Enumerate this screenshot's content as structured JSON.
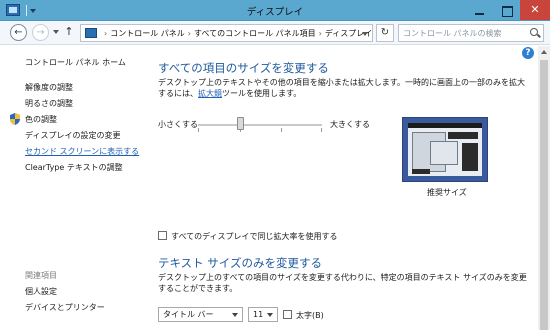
{
  "window": {
    "title": "ディスプレイ",
    "close_glyph": "✕"
  },
  "navigation": {
    "back_glyph": "←",
    "forward_glyph": "→",
    "up_glyph": "↑",
    "refresh_glyph": "↻",
    "breadcrumb": [
      "コントロール パネル",
      "すべてのコントロール パネル項目",
      "ディスプレイ"
    ],
    "breadcrumb_separator": "›",
    "search_placeholder": "コントロール パネルの検索"
  },
  "help_label": "?",
  "sidebar": {
    "home": "コントロール パネル ホーム",
    "items": [
      {
        "label": "解像度の調整"
      },
      {
        "label": "明るさの調整"
      },
      {
        "label": "色の調整"
      },
      {
        "label": "ディスプレイの設定の変更"
      },
      {
        "label": "セカンド スクリーンに表示する"
      },
      {
        "label": "ClearType テキストの調整"
      }
    ],
    "related_heading": "関連項目",
    "related": [
      {
        "label": "個人設定"
      },
      {
        "label": "デバイスとプリンター"
      }
    ]
  },
  "size_section": {
    "heading": "すべての項目のサイズを変更する",
    "description_before_link": "デスクトップ上のテキストやその他の項目を縮小または拡大します。一時的に画面上の一部のみを拡大するには、",
    "magnifier_link": "拡大鏡",
    "description_after_link": "ツールを使用します。",
    "slider_min_label": "小さくする",
    "slider_max_label": "大きくする",
    "slider_level": 0.33,
    "preview_caption": "推奨サイズ",
    "same_scale_label": "すべてのディスプレイで同じ拡大率を使用する",
    "same_scale_checked": false
  },
  "text_section": {
    "heading": "テキスト サイズのみを変更する",
    "description": "デスクトップ上のすべての項目のサイズを変更する代わりに、特定の項目のテキスト サイズのみを変更することができます。",
    "item_select": "タイトル バー",
    "size_select": "11",
    "bold_label": "太字(B)",
    "bold_checked": false
  },
  "colors": {
    "titlebar": "#5aa7cf",
    "heading": "#1e5a9e",
    "link": "#1e5fb4",
    "close": "#c9453c"
  }
}
